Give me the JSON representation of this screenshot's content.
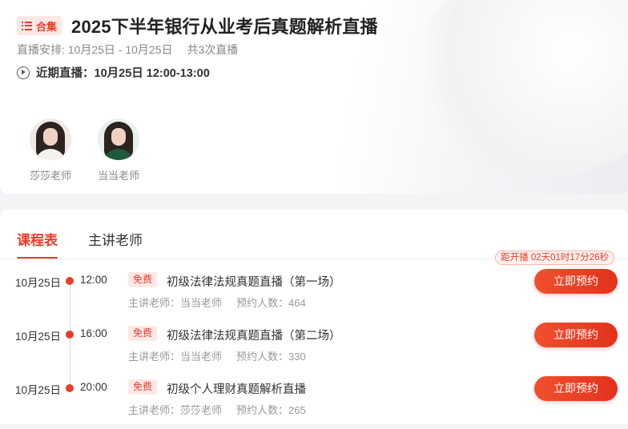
{
  "header": {
    "badge_label": "合集",
    "title": "2025下半年银行从业考后真题解析直播",
    "schedule_label": "直播安排: 10月25日 - 10月25日",
    "session_count": "共3次直播",
    "next_live": "近期直播：10月25日 12:00-13:00"
  },
  "teachers": [
    {
      "name": "莎莎老师"
    },
    {
      "name": "当当老师"
    }
  ],
  "tabs": [
    {
      "label": "课程表",
      "active": true
    },
    {
      "label": "主讲老师",
      "active": false
    }
  ],
  "countdown": "距开播 02天01时17分26秒",
  "sessions": [
    {
      "date": "10月25日",
      "time": "12:00",
      "tag": "免费",
      "title": "初级法律法规真题直播（第一场）",
      "teacher": "主讲老师：当当老师",
      "bookings": "预约人数：464",
      "button": "立即预约"
    },
    {
      "date": "10月25日",
      "time": "16:00",
      "tag": "免费",
      "title": "初级法律法规真题直播（第二场）",
      "teacher": "主讲老师：当当老师",
      "bookings": "预约人数：330",
      "button": "立即预约"
    },
    {
      "date": "10月25日",
      "time": "20:00",
      "tag": "免费",
      "title": "初级个人理财真题解析直播",
      "teacher": "主讲老师：莎莎老师",
      "bookings": "预约人数：265",
      "button": "立即预约"
    }
  ],
  "colors": {
    "accent": "#e83c26",
    "badge_bg": "#fde8e5"
  },
  "icons": {
    "badge": "list-icon",
    "next_live": "play-circle-icon"
  }
}
